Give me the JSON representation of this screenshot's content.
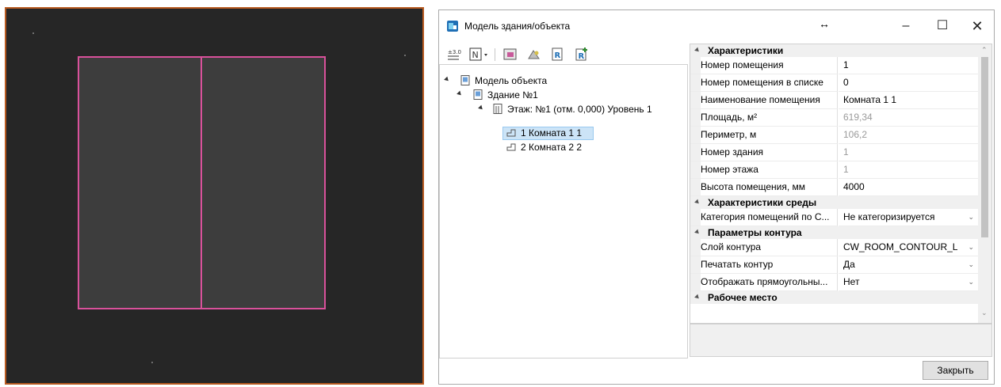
{
  "colors": {
    "cad_background": "#262626",
    "viewport_border": "#b85a20",
    "room_outline": "#d9519b",
    "room_fill": "#3d3d3d",
    "selection": "#cce4f7"
  },
  "window": {
    "title": "Модель здания/объекта",
    "resize_icon": "↔",
    "minimize": "–",
    "maximize": "☐",
    "close": "✕"
  },
  "toolbar": {
    "icons": [
      "elevation-icon",
      "numbering-icon",
      "room-icon",
      "render-icon",
      "report-icon",
      "report-add-icon"
    ]
  },
  "tree": {
    "nodes": [
      {
        "label": "Модель объекта",
        "icon": "model-icon"
      },
      {
        "label": "Здание №1",
        "icon": "building-icon"
      },
      {
        "label": "Этаж: №1 (отм. 0,000) Уровень 1",
        "icon": "floor-icon"
      },
      {
        "label": "1 Комната 1 1",
        "icon": "room-icon",
        "selected": true
      },
      {
        "label": "2 Комната 2 2",
        "icon": "room-icon"
      }
    ]
  },
  "grid": {
    "cat1": "Характеристики",
    "props1": [
      {
        "name": "Номер помещения",
        "value": "1"
      },
      {
        "name": "Номер помещения в списке",
        "value": "0"
      },
      {
        "name": "Наименование помещения",
        "value": "Комната 1 1"
      },
      {
        "name": "Площадь, м²",
        "value": "619,34"
      },
      {
        "name": "Периметр, м",
        "value": "106,2"
      },
      {
        "name": "Номер здания",
        "value": "1"
      },
      {
        "name": "Номер этажа",
        "value": "1"
      },
      {
        "name": "Высота помещения, мм",
        "value": "4000"
      }
    ],
    "cat2": "Характеристики среды",
    "props2": [
      {
        "name": "Категория помещений по С...",
        "value": "Не категоризируется"
      }
    ],
    "cat3": "Параметры контура",
    "props3": [
      {
        "name": "Слой контура",
        "value": "CW_ROOM_CONTOUR_L"
      },
      {
        "name": "Печатать контур",
        "value": "Да"
      },
      {
        "name": "Отображать прямоугольны...",
        "value": "Нет"
      }
    ],
    "cat4": "Рабочее место"
  },
  "buttons": {
    "close": "Закрыть"
  }
}
